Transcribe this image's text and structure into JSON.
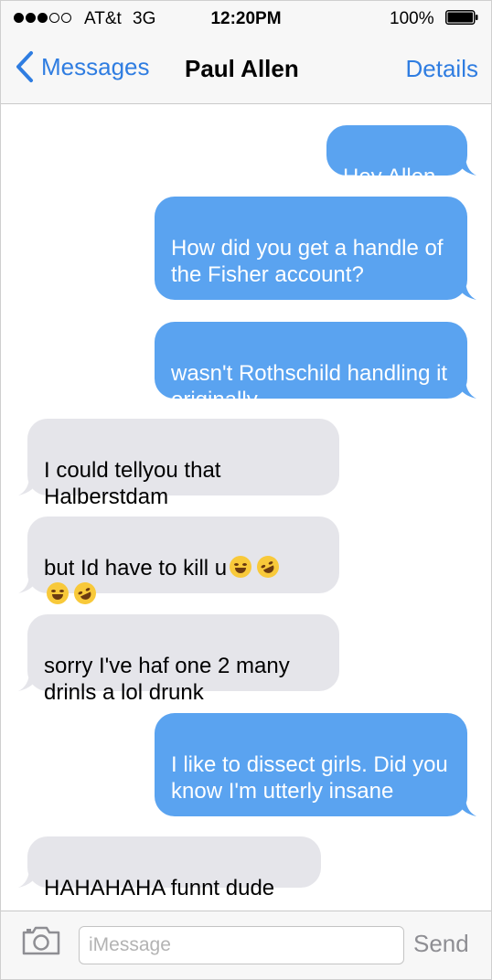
{
  "status_bar": {
    "carrier": "AT&t",
    "network": "3G",
    "time": "12:20PM",
    "battery": "100%",
    "signal_bars_filled": 3,
    "signal_bars_total": 5
  },
  "nav": {
    "back_label": "Messages",
    "title": "Paul Allen",
    "details_label": "Details"
  },
  "messages": [
    {
      "direction": "sent",
      "text": "Hey Allen"
    },
    {
      "direction": "sent",
      "text": "How did you get a handle of the Fisher account?"
    },
    {
      "direction": "sent",
      "text": "wasn't Rothschild handling it originally"
    },
    {
      "direction": "received",
      "text": "I could tellyou that Halberstdam"
    },
    {
      "direction": "received",
      "text": "but Id have to kill u",
      "emoji": [
        "tears-of-joy",
        "rolling-laughing",
        "tears-of-joy",
        "rolling-laughing"
      ]
    },
    {
      "direction": "received",
      "text": "sorry I've haf one 2 many drinls a lol drunk"
    },
    {
      "direction": "sent",
      "text": "I like to dissect girls. Did you know I'm utterly insane"
    },
    {
      "direction": "received",
      "text": "HAHAHAHA funnt dude"
    }
  ],
  "input": {
    "placeholder": "iMessage",
    "value": "",
    "send_label": "Send"
  },
  "colors": {
    "sent_bubble": "#5aa3f0",
    "received_bubble": "#e5e5ea",
    "accent": "#2f7de1",
    "send_disabled": "#8e8e93"
  },
  "icons": {
    "back": "chevron-left-icon",
    "camera": "camera-icon",
    "battery": "battery-icon"
  }
}
